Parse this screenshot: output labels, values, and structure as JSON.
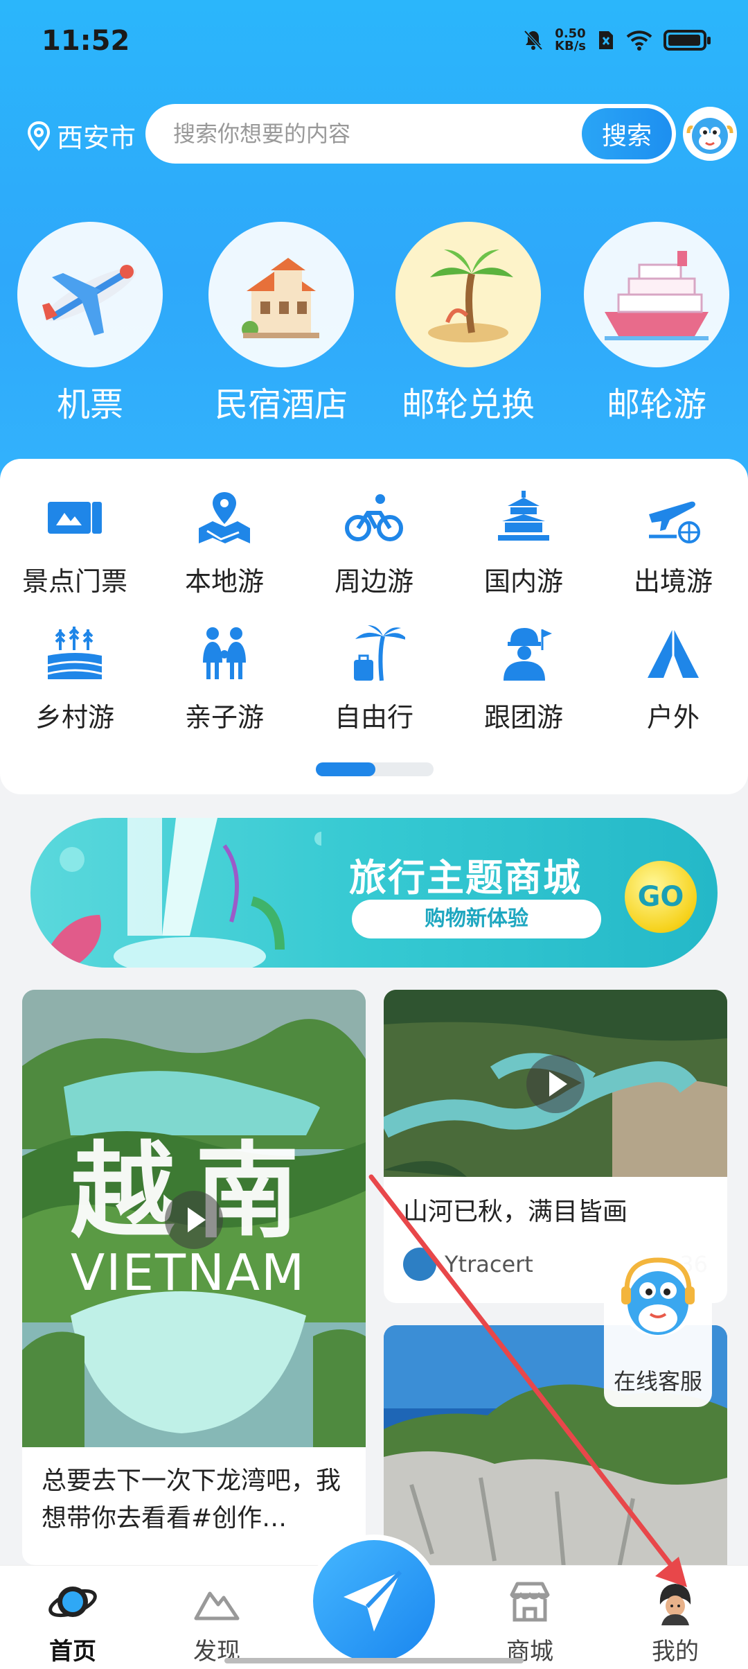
{
  "status_bar": {
    "time": "11:52",
    "net_speed_value": "0.50",
    "net_speed_unit": "KB/s",
    "icons": [
      "mute-bell-icon",
      "sim-x-icon",
      "wifi-icon",
      "battery-icon"
    ],
    "battery_level": 0.85
  },
  "header": {
    "location": "西安市",
    "search_placeholder": "搜索你想要的内容",
    "search_button": "搜索"
  },
  "features": [
    {
      "label": "机票",
      "icon": "airplane-icon"
    },
    {
      "label": "民宿酒店",
      "icon": "hotel-house-icon"
    },
    {
      "label": "邮轮兑换",
      "icon": "palm-island-icon"
    },
    {
      "label": "邮轮游",
      "icon": "cruise-ship-icon"
    }
  ],
  "categories": [
    {
      "label": "景点门票",
      "icon": "ticket-icon"
    },
    {
      "label": "本地游",
      "icon": "map-pin-icon"
    },
    {
      "label": "周边游",
      "icon": "bicycle-icon"
    },
    {
      "label": "国内游",
      "icon": "temple-icon"
    },
    {
      "label": "出境游",
      "icon": "plane-globe-icon"
    },
    {
      "label": "乡村游",
      "icon": "farm-icon"
    },
    {
      "label": "亲子游",
      "icon": "family-icon"
    },
    {
      "label": "自由行",
      "icon": "palm-luggage-icon"
    },
    {
      "label": "跟团游",
      "icon": "guide-flag-icon"
    },
    {
      "label": "户外",
      "icon": "tent-icon"
    }
  ],
  "pager": {
    "active_page": 1,
    "total_pages": 2
  },
  "banner": {
    "title": "旅行主题商城",
    "subtitle": "购物新体验",
    "go_label": "GO"
  },
  "feed": {
    "left_card": {
      "image_text_cn": "越南",
      "image_text_en": "VIETNAM",
      "title": "总要去下一次下龙湾吧，我想带你去看看#创作…"
    },
    "right_card_1": {
      "title": "山河已秋，满目皆画",
      "author": "Ytracert",
      "likes": "36"
    }
  },
  "service": {
    "label": "在线客服"
  },
  "bottom_nav": [
    {
      "label": "首页",
      "icon": "home-planet-icon",
      "active": true
    },
    {
      "label": "发现",
      "icon": "mountain-icon",
      "active": false
    },
    {
      "label": "",
      "icon": "paper-plane-icon",
      "active": false
    },
    {
      "label": "商城",
      "icon": "shop-icon",
      "active": false
    },
    {
      "label": "我的",
      "icon": "profile-avatar-icon",
      "active": false
    }
  ],
  "colors": {
    "accent": "#1f86e8",
    "header_blue": "#2bb6fb",
    "annotation_arrow": "#e8474a"
  }
}
